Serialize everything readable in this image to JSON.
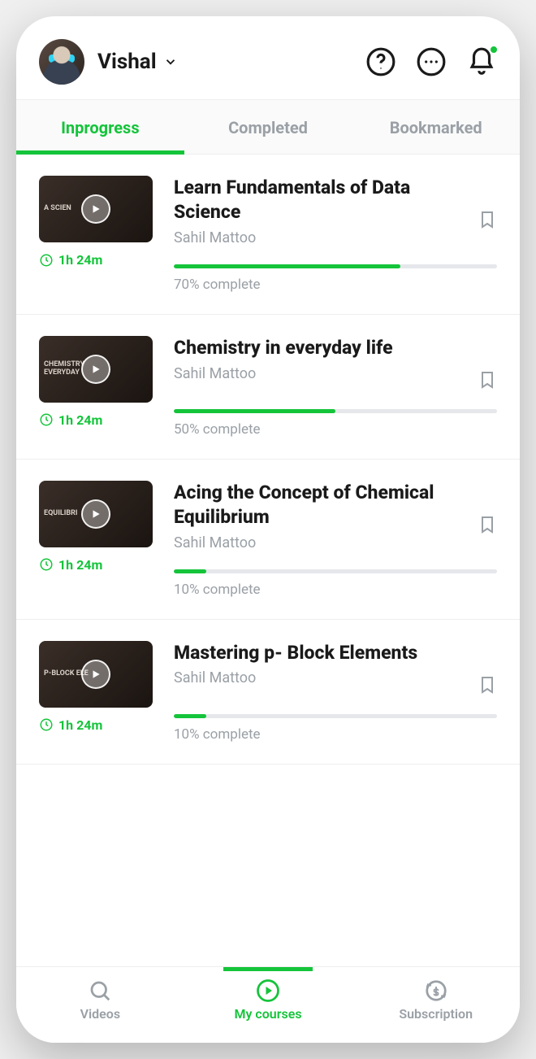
{
  "header": {
    "user_name": "Vishal",
    "icons": {
      "help": "help-icon",
      "chat": "chat-icon",
      "bell": "bell-icon"
    }
  },
  "tabs": [
    {
      "label": "Inprogress",
      "active": true
    },
    {
      "label": "Completed",
      "active": false
    },
    {
      "label": "Bookmarked",
      "active": false
    }
  ],
  "courses": [
    {
      "title": "Learn Fundamentals of Data Science",
      "author": "Sahil Mattoo",
      "duration": "1h 24m",
      "progress": 70,
      "completion_label": "70% complete",
      "thumb_label": "a Scien"
    },
    {
      "title": "Chemistry in everyday life",
      "author": "Sahil Mattoo",
      "duration": "1h 24m",
      "progress": 50,
      "completion_label": "50% complete",
      "thumb_label": "CHEMISTRY\nEVERYDAY"
    },
    {
      "title": "Acing the Concept of Chemical Equilibrium",
      "author": "Sahil Mattoo",
      "duration": "1h 24m",
      "progress": 10,
      "completion_label": "10% complete",
      "thumb_label": "EQUILIBRI"
    },
    {
      "title": "Mastering p- Block Elements",
      "author": "Sahil Mattoo",
      "duration": "1h 24m",
      "progress": 10,
      "completion_label": "10% complete",
      "thumb_label": "p-BLOCK ELE"
    }
  ],
  "bottom_nav": [
    {
      "label": "Videos",
      "icon": "search-icon",
      "active": false
    },
    {
      "label": "My courses",
      "icon": "play-circle-icon",
      "active": true
    },
    {
      "label": "Subscription",
      "icon": "refresh-dollar-icon",
      "active": false
    }
  ],
  "colors": {
    "accent": "#14c43a"
  }
}
